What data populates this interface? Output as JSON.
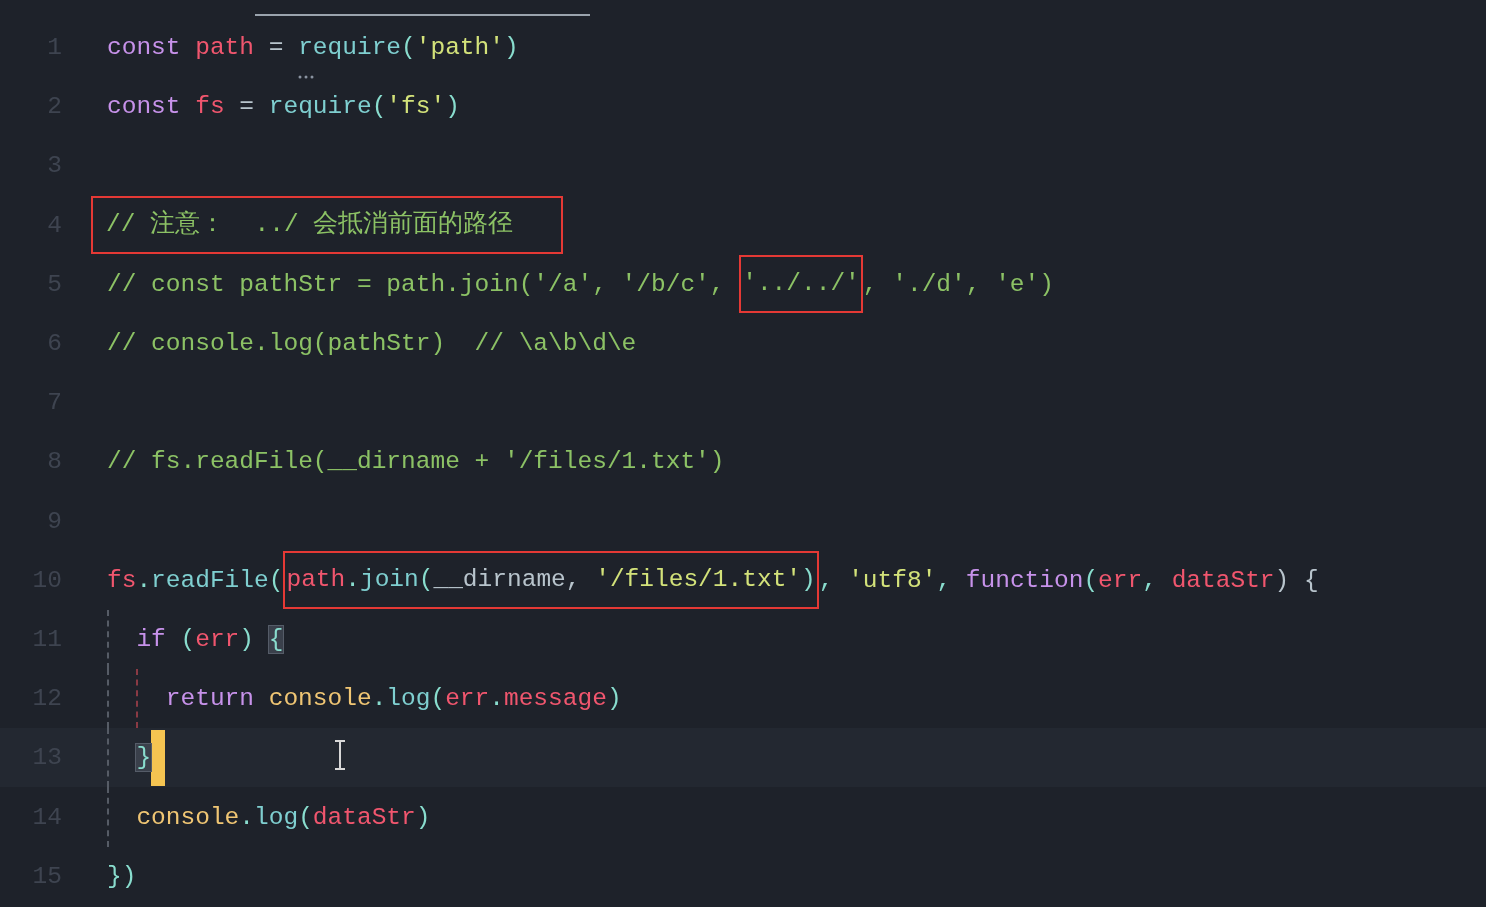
{
  "editor": {
    "lines": [
      {
        "number": "1",
        "hint": true,
        "tokens": [
          {
            "kind": "keyword",
            "text": "const "
          },
          {
            "kind": "variable",
            "text": "path"
          },
          {
            "kind": "plain",
            "text": " = "
          },
          {
            "kind": "function",
            "text": "require"
          },
          {
            "kind": "punct",
            "text": "("
          },
          {
            "kind": "string",
            "text": "'path'"
          },
          {
            "kind": "punct",
            "text": ")"
          }
        ]
      },
      {
        "number": "2",
        "tokens": [
          {
            "kind": "keyword",
            "text": "const "
          },
          {
            "kind": "variable",
            "text": "fs"
          },
          {
            "kind": "plain",
            "text": " = "
          },
          {
            "kind": "function",
            "text": "require"
          },
          {
            "kind": "punct",
            "text": "("
          },
          {
            "kind": "string",
            "text": "'fs'"
          },
          {
            "kind": "punct",
            "text": ")"
          }
        ]
      },
      {
        "number": "3"
      },
      {
        "number": "4",
        "tokens": [
          {
            "kind": "box",
            "tokens": [
              {
                "kind": "comment",
                "text": "// 注意：  ../ 会抵消前面的路径"
              }
            ]
          }
        ]
      },
      {
        "number": "5",
        "tokens": [
          {
            "kind": "comment",
            "text": "// const pathStr = path.join('/a', '/b/c', "
          },
          {
            "kind": "box",
            "tokens": [
              {
                "kind": "comment",
                "text": "'../../'"
              }
            ]
          },
          {
            "kind": "comment",
            "text": ", './d', 'e')"
          }
        ]
      },
      {
        "number": "6",
        "tokens": [
          {
            "kind": "comment",
            "text": "// console.log(pathStr)  // \\a\\b\\d\\e"
          }
        ]
      },
      {
        "number": "7"
      },
      {
        "number": "8",
        "tokens": [
          {
            "kind": "comment",
            "text": "// fs.readFile(__dirname + '/files/1.txt')"
          }
        ]
      },
      {
        "number": "9"
      },
      {
        "number": "10",
        "tokens": [
          {
            "kind": "variable",
            "text": "fs"
          },
          {
            "kind": "punct",
            "text": "."
          },
          {
            "kind": "function",
            "text": "readFile"
          },
          {
            "kind": "punct",
            "text": "("
          },
          {
            "kind": "box",
            "tokens": [
              {
                "kind": "variable",
                "text": "path"
              },
              {
                "kind": "punct",
                "text": "."
              },
              {
                "kind": "function",
                "text": "join"
              },
              {
                "kind": "punct",
                "text": "("
              },
              {
                "kind": "plain",
                "text": "__dirname, "
              },
              {
                "kind": "string",
                "text": "'/files/1.txt'"
              },
              {
                "kind": "punct",
                "text": ")"
              }
            ]
          },
          {
            "kind": "punct",
            "text": ", "
          },
          {
            "kind": "string",
            "text": "'utf8'"
          },
          {
            "kind": "punct",
            "text": ", "
          },
          {
            "kind": "keyword",
            "text": "function"
          },
          {
            "kind": "punct",
            "text": "("
          },
          {
            "kind": "variable",
            "text": "err"
          },
          {
            "kind": "punct",
            "text": ", "
          },
          {
            "kind": "variable",
            "text": "dataStr"
          },
          {
            "kind": "plain",
            "text": ") {"
          }
        ],
        "children": [
          {
            "number": "11",
            "tokens": [
              {
                "kind": "keyword",
                "text": "if"
              },
              {
                "kind": "punct",
                "text": " ("
              },
              {
                "kind": "variable",
                "text": "err"
              },
              {
                "kind": "punct",
                "text": ") "
              },
              {
                "kind": "bracket_match",
                "text": "{"
              }
            ],
            "children": [
              {
                "number": "12",
                "tokens": [
                  {
                    "kind": "keyword",
                    "text": "return "
                  },
                  {
                    "kind": "object",
                    "text": "console"
                  },
                  {
                    "kind": "punct",
                    "text": "."
                  },
                  {
                    "kind": "function",
                    "text": "log"
                  },
                  {
                    "kind": "punct",
                    "text": "("
                  },
                  {
                    "kind": "variable",
                    "text": "err"
                  },
                  {
                    "kind": "punct",
                    "text": "."
                  },
                  {
                    "kind": "variable",
                    "text": "message"
                  },
                  {
                    "kind": "punct",
                    "text": ")"
                  }
                ]
              }
            ]
          },
          {
            "number": "13",
            "current": true,
            "cursor": true,
            "tokens": [
              {
                "kind": "bracket_match",
                "text": "}"
              }
            ]
          },
          {
            "number": "14",
            "tokens": [
              {
                "kind": "object",
                "text": "console"
              },
              {
                "kind": "punct",
                "text": "."
              },
              {
                "kind": "function",
                "text": "log"
              },
              {
                "kind": "punct",
                "text": "("
              },
              {
                "kind": "variable",
                "text": "dataStr"
              },
              {
                "kind": "punct",
                "text": ")"
              }
            ]
          }
        ]
      },
      {
        "number": "15",
        "tokens": [
          {
            "kind": "punct",
            "text": "})"
          }
        ]
      }
    ]
  }
}
